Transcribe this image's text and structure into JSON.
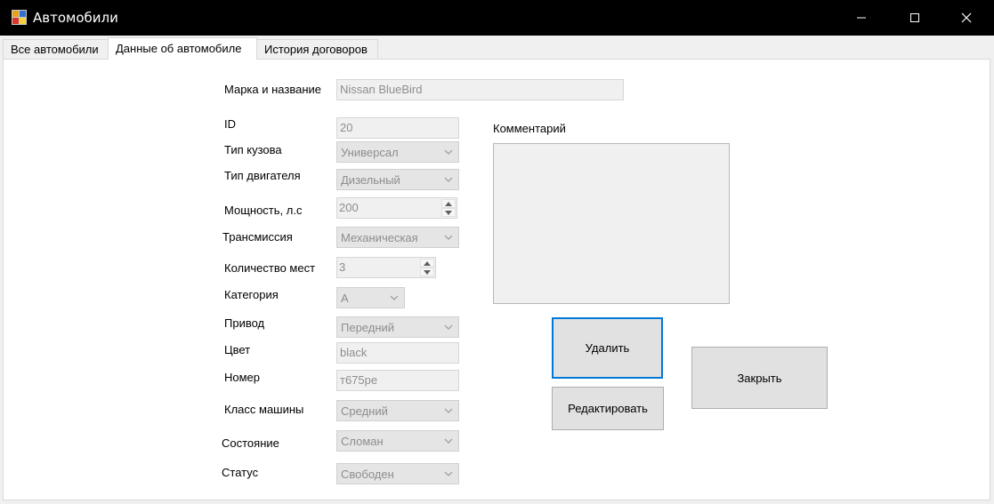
{
  "window": {
    "title": "Автомобили",
    "icon": "app-icon",
    "controls": [
      "minimize-icon",
      "maximize-icon",
      "close-icon"
    ]
  },
  "tabs": [
    {
      "label": "Все автомобили",
      "active": false
    },
    {
      "label": "Данные об автомобиле",
      "active": true
    },
    {
      "label": "История договоров",
      "active": false
    }
  ],
  "form": {
    "name": {
      "label": "Марка и название",
      "value": "Nissan BlueBird"
    },
    "id": {
      "label": "ID",
      "value": "20"
    },
    "body_type": {
      "label": "Тип кузова",
      "value": "Универсал"
    },
    "engine_type": {
      "label": "Тип двигателя",
      "value": "Дизельный"
    },
    "power": {
      "label": "Мощность, л.с",
      "value": "200"
    },
    "transmission": {
      "label": "Трансмиссия",
      "value": "Механическая"
    },
    "seats": {
      "label": "Количество мест",
      "value": "3"
    },
    "category": {
      "label": "Категория",
      "value": "A"
    },
    "drive": {
      "label": "Привод",
      "value": "Передний"
    },
    "color": {
      "label": "Цвет",
      "value": "black"
    },
    "plate": {
      "label": "Номер",
      "value": "т675ре"
    },
    "car_class": {
      "label": "Класс машины",
      "value": "Средний"
    },
    "condition": {
      "label": "Состояние",
      "value": "Сломан"
    },
    "status": {
      "label": "Статус",
      "value": "Свободен"
    },
    "comment": {
      "label": "Комментарий",
      "value": ""
    }
  },
  "buttons": {
    "delete": "Удалить",
    "edit": "Редактировать",
    "close": "Закрыть"
  },
  "colors": {
    "focus": "#0078d7",
    "disabled_text": "#8d8d8d"
  }
}
